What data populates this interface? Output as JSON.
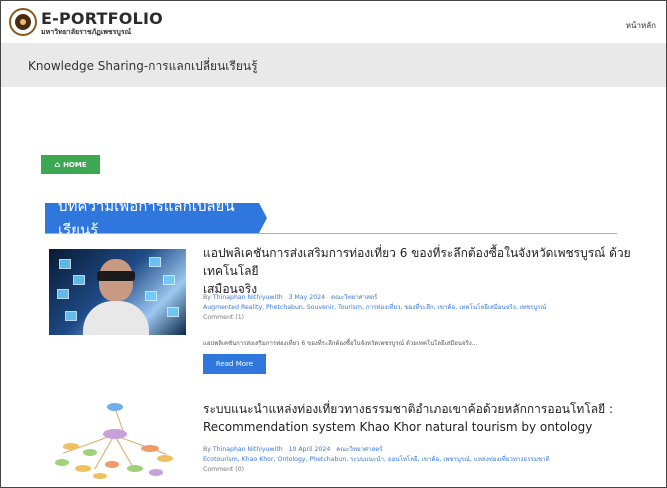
{
  "header": {
    "brand": "E-PORTFOLIO",
    "brand_sub": "มหาวิทยาลัยราชภัฏเพชรบูรณ์",
    "home_link": "หน้าหลัก"
  },
  "subheader": {
    "title": "Knowledge Sharing-การแลกเปลี่ยนเรียนรู้"
  },
  "breadcrumb": {
    "home_label": "HOME",
    "home_icon": "home-icon"
  },
  "section": {
    "title": "บทความเพื่อการแลกเปลี่ยนเรียนรู้"
  },
  "articles": [
    {
      "title_line1": "แอปพลิเคชันการส่งเสริมการท่องเที่ยว 6 ของที่ระลึกต้องซื้อในจังหวัดเพชรบูรณ์ ด้วยเทคโนโลยี",
      "title_line2": "เสมือนจริง",
      "by_prefix": "By",
      "author": "Thinaphan Nithiyuwith",
      "date": "3 May 2024",
      "category": "คณะวิทยาศาสตร์",
      "tags": "Augmented Reality, Phetchabun, Souvenir, Tourism, การท่องเที่ยว, ของที่ระลึก, เขาค้อ, เทคโนโลยีเสมือนจริง, เพชรบูรณ์",
      "comments": "Comment (1)",
      "excerpt": "แอปพลิเคชันการส่งเสริมการท่องเที่ยว 6 ของที่ระลึกต้องซื้อในจังหวัดเพชรบูรณ์ ด้วยเทคโนโลยีเสมือนจริง...",
      "read_more": "Read More"
    },
    {
      "title_line1": "ระบบแนะนำแหล่งท่องเที่ยวทางธรรมชาติอำเภอเขาค้อด้วยหลักการออนโทโลยี :",
      "title_line2": "Recommendation system Khao Khor natural tourism by ontology",
      "by_prefix": "By",
      "author": "Thinaphan Nithiyuwith",
      "date": "10 April 2024",
      "category": "คณะวิทยาศาสตร์",
      "tags": "Ecotourism, Khao Khor, Ontology, Phetchabun, ระบบแนะนำ, ออนโทโลยี, เขาค้อ, เพชรบูรณ์, แหล่งท่องเที่ยวทางธรรมชาติ",
      "comments": "Comment (0)"
    }
  ],
  "colors": {
    "accent": "#2f77dc",
    "home_button": "#3da852",
    "subheader_bg": "#e9e9e9"
  }
}
